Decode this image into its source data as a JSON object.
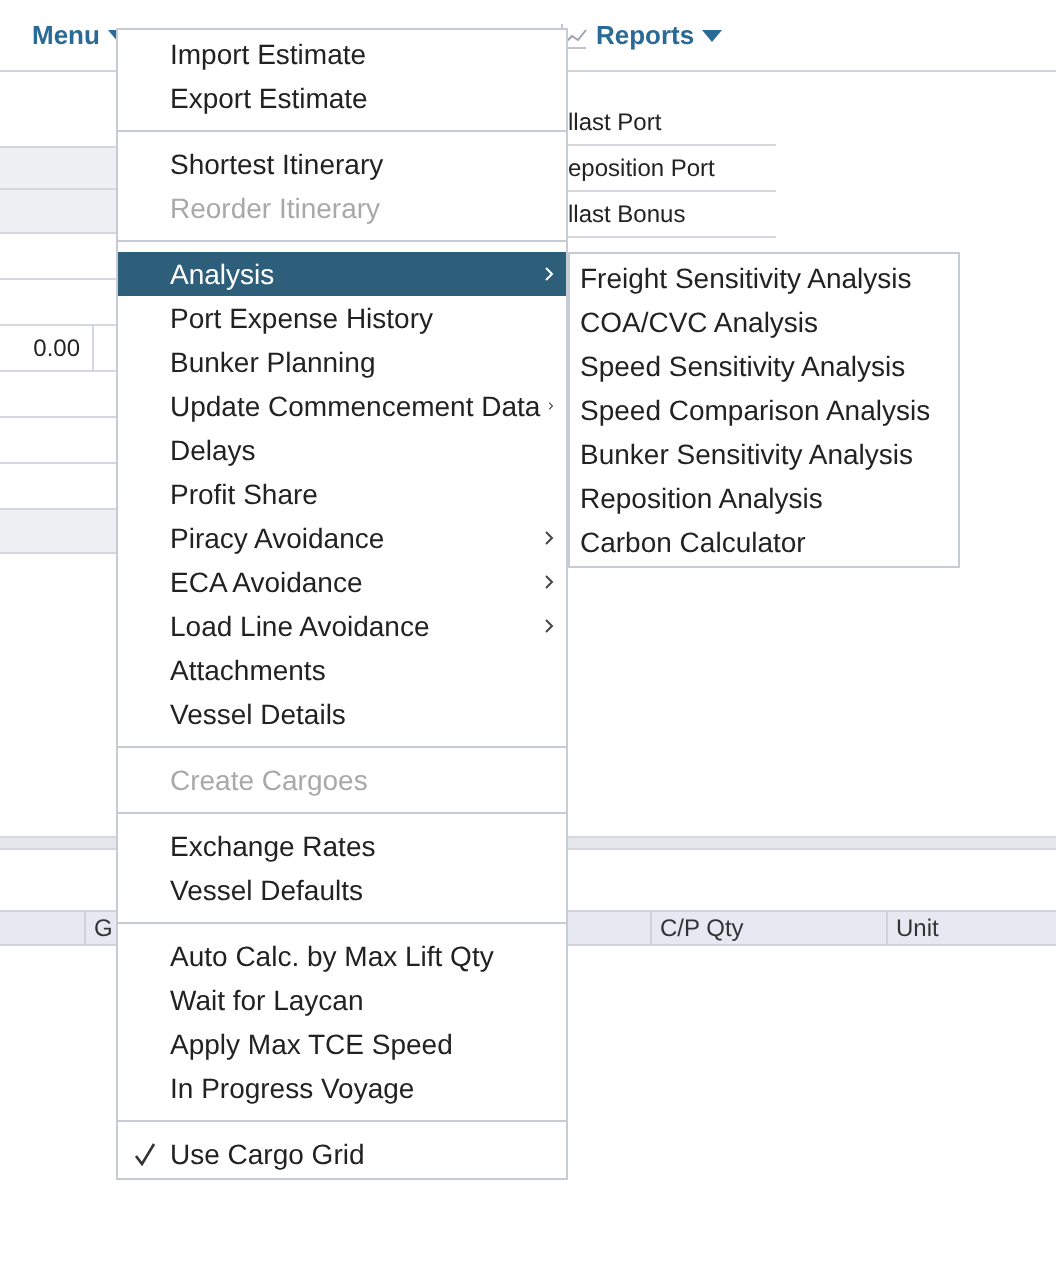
{
  "toolbar": [
    {
      "label": "Menu",
      "kind": "dropdown"
    },
    {
      "label": "Reports",
      "kind": "chart-dropdown"
    }
  ],
  "form": {
    "value_cell": "0.00",
    "labels": [
      "llast Port",
      "eposition Port",
      "llast Bonus"
    ]
  },
  "grid": {
    "columns": [
      "G",
      "C/P Qty",
      "Unit"
    ]
  },
  "menu": {
    "groups": [
      [
        {
          "label": "Import Estimate",
          "disabled": false,
          "submenu": false,
          "selected": false,
          "checked": false
        },
        {
          "label": "Export Estimate",
          "disabled": false,
          "submenu": false,
          "selected": false,
          "checked": false
        }
      ],
      [
        {
          "label": "Shortest Itinerary",
          "disabled": false,
          "submenu": false,
          "selected": false,
          "checked": false
        },
        {
          "label": "Reorder Itinerary",
          "disabled": true,
          "submenu": false,
          "selected": false,
          "checked": false
        }
      ],
      [
        {
          "label": "Analysis",
          "disabled": false,
          "submenu": true,
          "selected": true,
          "checked": false
        },
        {
          "label": "Port Expense History",
          "disabled": false,
          "submenu": false,
          "selected": false,
          "checked": false
        },
        {
          "label": "Bunker Planning",
          "disabled": false,
          "submenu": false,
          "selected": false,
          "checked": false
        },
        {
          "label": "Update Commencement Data",
          "disabled": false,
          "submenu": true,
          "selected": false,
          "checked": false
        },
        {
          "label": "Delays",
          "disabled": false,
          "submenu": false,
          "selected": false,
          "checked": false
        },
        {
          "label": "Profit Share",
          "disabled": false,
          "submenu": false,
          "selected": false,
          "checked": false
        },
        {
          "label": "Piracy Avoidance",
          "disabled": false,
          "submenu": true,
          "selected": false,
          "checked": false
        },
        {
          "label": "ECA Avoidance",
          "disabled": false,
          "submenu": true,
          "selected": false,
          "checked": false
        },
        {
          "label": "Load Line Avoidance",
          "disabled": false,
          "submenu": true,
          "selected": false,
          "checked": false
        },
        {
          "label": "Attachments",
          "disabled": false,
          "submenu": false,
          "selected": false,
          "checked": false
        },
        {
          "label": "Vessel Details",
          "disabled": false,
          "submenu": false,
          "selected": false,
          "checked": false
        }
      ],
      [
        {
          "label": "Create Cargoes",
          "disabled": true,
          "submenu": false,
          "selected": false,
          "checked": false
        }
      ],
      [
        {
          "label": "Exchange Rates",
          "disabled": false,
          "submenu": false,
          "selected": false,
          "checked": false
        },
        {
          "label": "Vessel Defaults",
          "disabled": false,
          "submenu": false,
          "selected": false,
          "checked": false
        }
      ],
      [
        {
          "label": "Auto Calc. by Max Lift Qty",
          "disabled": false,
          "submenu": false,
          "selected": false,
          "checked": false
        },
        {
          "label": "Wait for Laycan",
          "disabled": false,
          "submenu": false,
          "selected": false,
          "checked": false
        },
        {
          "label": "Apply Max TCE Speed",
          "disabled": false,
          "submenu": false,
          "selected": false,
          "checked": false
        },
        {
          "label": "In Progress Voyage",
          "disabled": false,
          "submenu": false,
          "selected": false,
          "checked": false
        }
      ],
      [
        {
          "label": "Use Cargo Grid",
          "disabled": false,
          "submenu": false,
          "selected": false,
          "checked": true
        }
      ]
    ]
  },
  "submenu": {
    "items": [
      "Freight Sensitivity Analysis",
      "COA/CVC Analysis",
      "Speed Sensitivity Analysis",
      "Speed Comparison Analysis",
      "Bunker Sensitivity Analysis",
      "Reposition Analysis",
      "Carbon Calculator"
    ]
  }
}
